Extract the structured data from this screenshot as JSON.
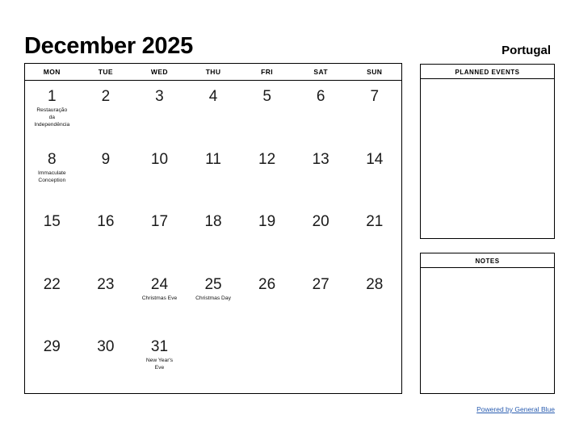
{
  "header": {
    "title": "December 2025",
    "country": "Portugal"
  },
  "calendar": {
    "weekdays": [
      "MON",
      "TUE",
      "WED",
      "THU",
      "FRI",
      "SAT",
      "SUN"
    ],
    "weeks": [
      [
        {
          "day": "1",
          "event": "Restauração\nda\nIndependência"
        },
        {
          "day": "2",
          "event": ""
        },
        {
          "day": "3",
          "event": ""
        },
        {
          "day": "4",
          "event": ""
        },
        {
          "day": "5",
          "event": ""
        },
        {
          "day": "6",
          "event": ""
        },
        {
          "day": "7",
          "event": ""
        }
      ],
      [
        {
          "day": "8",
          "event": "Immaculate\nConception"
        },
        {
          "day": "9",
          "event": ""
        },
        {
          "day": "10",
          "event": ""
        },
        {
          "day": "11",
          "event": ""
        },
        {
          "day": "12",
          "event": ""
        },
        {
          "day": "13",
          "event": ""
        },
        {
          "day": "14",
          "event": ""
        }
      ],
      [
        {
          "day": "15",
          "event": ""
        },
        {
          "day": "16",
          "event": ""
        },
        {
          "day": "17",
          "event": ""
        },
        {
          "day": "18",
          "event": ""
        },
        {
          "day": "19",
          "event": ""
        },
        {
          "day": "20",
          "event": ""
        },
        {
          "day": "21",
          "event": ""
        }
      ],
      [
        {
          "day": "22",
          "event": ""
        },
        {
          "day": "23",
          "event": ""
        },
        {
          "day": "24",
          "event": "Christmas Eve"
        },
        {
          "day": "25",
          "event": "Christmas Day"
        },
        {
          "day": "26",
          "event": ""
        },
        {
          "day": "27",
          "event": ""
        },
        {
          "day": "28",
          "event": ""
        }
      ],
      [
        {
          "day": "29",
          "event": ""
        },
        {
          "day": "30",
          "event": ""
        },
        {
          "day": "31",
          "event": "New Year's\nEve"
        },
        {
          "day": "",
          "event": ""
        },
        {
          "day": "",
          "event": ""
        },
        {
          "day": "",
          "event": ""
        },
        {
          "day": "",
          "event": ""
        }
      ]
    ]
  },
  "panels": {
    "planned_events": {
      "title": "PLANNED EVENTS",
      "content": ""
    },
    "notes": {
      "title": "NOTES",
      "content": ""
    }
  },
  "footer": {
    "link_text": "Powered by General Blue",
    "link_color": "#2a5db0"
  }
}
